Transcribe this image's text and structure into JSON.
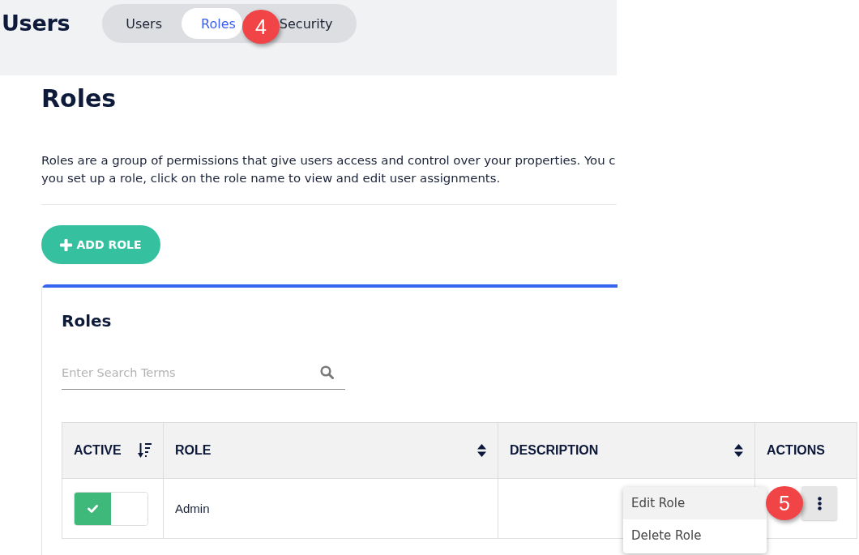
{
  "header": {
    "title": "Users",
    "tabs": [
      {
        "label": "Users",
        "selected": false
      },
      {
        "label": "Roles",
        "selected": true,
        "step_badge": "4"
      },
      {
        "label": "Security",
        "selected": false
      }
    ]
  },
  "page": {
    "title": "Roles",
    "description": [
      "Roles are a group of permissions that give users access and control over your properties. You c",
      "you set up a role, click on the role name to view and edit user assignments."
    ],
    "add_button": {
      "label": "ADD ROLE"
    }
  },
  "card": {
    "title": "Roles",
    "search": {
      "placeholder": "Enter Search Terms"
    },
    "table": {
      "columns": [
        {
          "label": "ACTIVE",
          "sortable": true,
          "sorted": true
        },
        {
          "label": "ROLE",
          "sortable": true,
          "sorted": false
        },
        {
          "label": "DESCRIPTION",
          "sortable": true,
          "sorted": false
        },
        {
          "label": "ACTIONS",
          "sortable": false,
          "sorted": false
        }
      ],
      "rows": [
        {
          "active": true,
          "role": "Admin",
          "actions_menu": {
            "open": true,
            "step_badge": "5",
            "items": [
              {
                "label": "Edit Role",
                "highlighted": true
              },
              {
                "label": "Delete Role",
                "highlighted": false
              }
            ]
          }
        }
      ]
    }
  }
}
